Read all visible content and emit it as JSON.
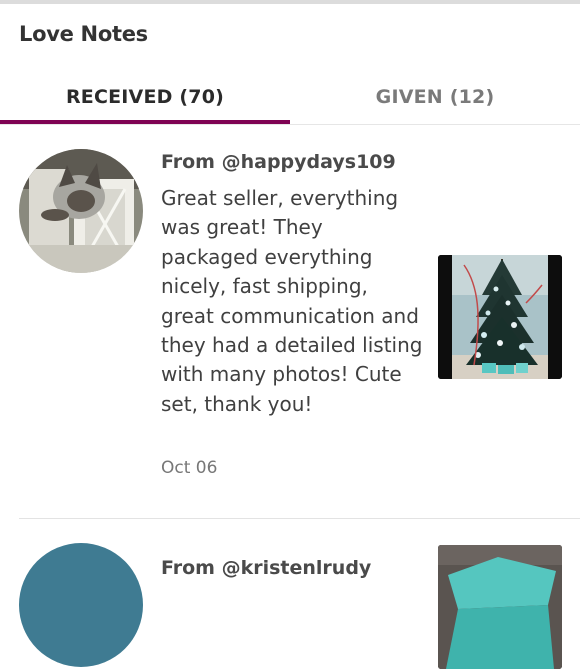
{
  "header": {
    "title": "Love Notes"
  },
  "tabs": [
    {
      "label": "RECEIVED (70)",
      "active": true
    },
    {
      "label": "GIVEN (12)",
      "active": false
    }
  ],
  "colors": {
    "accent": "#7f0353"
  },
  "notes": [
    {
      "from": "From @happydays109",
      "message": "Great seller, everything was great! They packaged everything nicely, fast shipping, great communication and they had a detailed listing with many photos! Cute set, thank you!",
      "date": "Oct 06"
    },
    {
      "from": "From @kristenlrudy"
    }
  ]
}
